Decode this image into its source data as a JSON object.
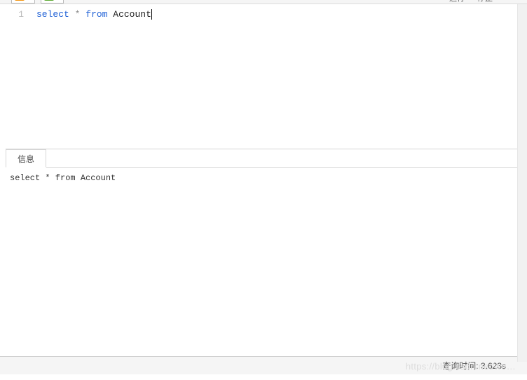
{
  "toolbar": {
    "run_label": "运行",
    "stop_label": "停止",
    "other_label": "…"
  },
  "editor": {
    "line_number": "1",
    "sql_keywords": {
      "select": "select",
      "star": "*",
      "from": "from"
    },
    "sql_identifier": "Account"
  },
  "results": {
    "tab_label": "信息",
    "output": "select * from Account"
  },
  "statusbar": {
    "query_time_label": "查询时间:",
    "query_time_value": "3.623s"
  },
  "watermark": "https://blog.csdn.net/we…"
}
